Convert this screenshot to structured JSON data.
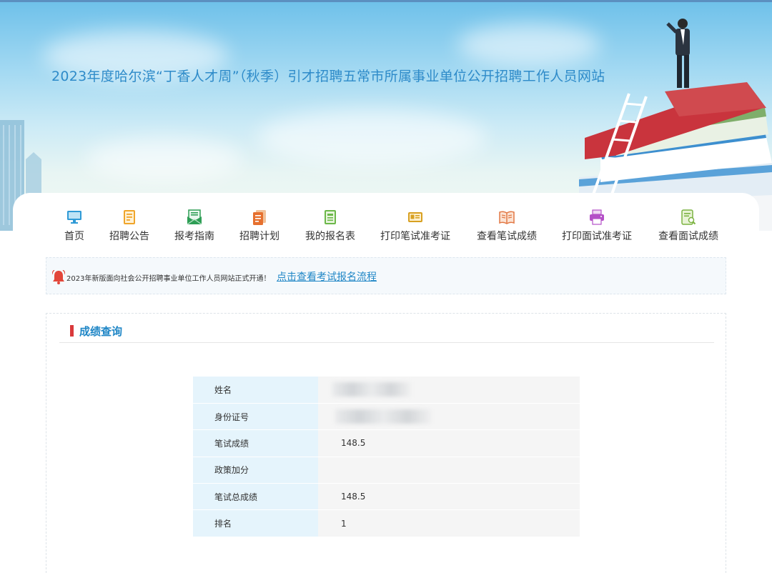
{
  "site": {
    "title": "2023年度哈尔滨“丁香人才周”（秋季）引才招聘五常市所属事业单位公开招聘工作人员网站"
  },
  "nav": {
    "items": [
      {
        "label": "首页",
        "icon": "monitor-icon"
      },
      {
        "label": "招聘公告",
        "icon": "notice-doc-icon"
      },
      {
        "label": "报考指南",
        "icon": "mail-guide-icon"
      },
      {
        "label": "招聘计划",
        "icon": "plan-doc-icon"
      },
      {
        "label": "我的报名表",
        "icon": "form-icon"
      },
      {
        "label": "打印笔试准考证",
        "icon": "id-card-icon"
      },
      {
        "label": "查看笔试成绩",
        "icon": "open-book-icon"
      },
      {
        "label": "打印面试准考证",
        "icon": "printer-icon"
      },
      {
        "label": "查看面试成绩",
        "icon": "doc-search-icon"
      }
    ]
  },
  "notice": {
    "text": "2023年新版面向社会公开招聘事业单位工作人员网站正式开通！",
    "link": "点击查看考试报名流程",
    "icon": "bell-icon"
  },
  "section": {
    "title": "成绩查询"
  },
  "scores": {
    "rows": [
      {
        "label": "姓名",
        "value": ""
      },
      {
        "label": "身份证号",
        "value": ""
      },
      {
        "label": "笔试成绩",
        "value": "148.5"
      },
      {
        "label": "政策加分",
        "value": ""
      },
      {
        "label": "笔试总成绩",
        "value": "148.5"
      },
      {
        "label": "排名",
        "value": "1"
      }
    ]
  },
  "colors": {
    "accent": "#1f86c6",
    "title_blue": "#2e8bc9",
    "section_bar": "#d9393b",
    "label_cell": "#e5f4fc",
    "value_cell": "#f5f5f5"
  }
}
